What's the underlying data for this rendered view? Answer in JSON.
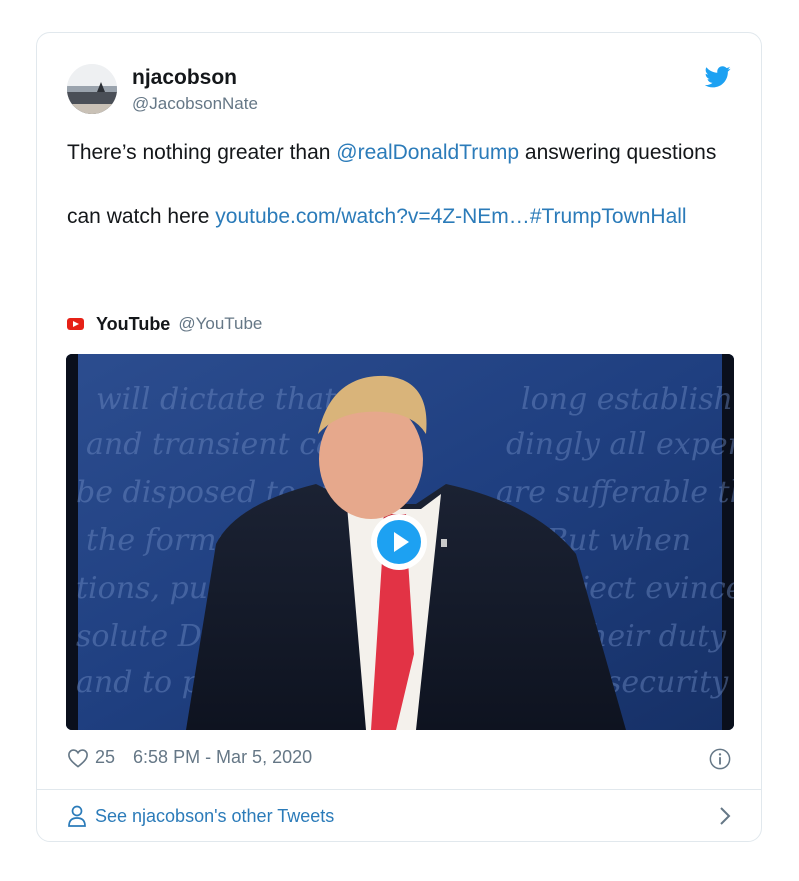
{
  "author": {
    "name": "njacobson",
    "handle": "@JacobsonNate"
  },
  "icons": {
    "avatar": "avatar-photo",
    "platform": "twitter-bird-icon",
    "source_logo": "youtube-logo-icon",
    "like": "heart-icon",
    "info": "info-icon",
    "profile": "person-icon",
    "more": "chevron-right-icon",
    "play": "play-icon"
  },
  "tweet": {
    "line1_before": "There’s nothing greater than ",
    "mention": "@realDonaldTrump",
    "line1_after": " answering questions",
    "line2_before": "can watch here ",
    "url": "youtube.com/watch?v=4Z-NEm…",
    "hashtag": "#TrumpTownHall"
  },
  "source": {
    "name": "YouTube",
    "handle": "@YouTube"
  },
  "stats": {
    "likes": "25",
    "timestamp": "6:58 PM - Mar 5, 2020"
  },
  "footer": {
    "label": "See njacobson's other Tweets"
  },
  "colors": {
    "link": "#2b7bb9",
    "twitter_blue": "#1da1f2",
    "muted": "#657786",
    "border": "#e1e8ed",
    "youtube_red": "#e62117"
  }
}
